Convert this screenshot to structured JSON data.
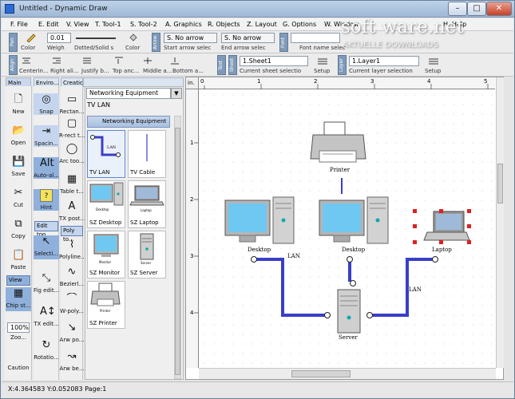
{
  "app": {
    "title": "Untitled - Dynamic Draw",
    "minimize": "–",
    "maximize": "□",
    "close": "✕"
  },
  "menu": {
    "items": [
      "F. File",
      "E. Edit",
      "V. View",
      "T. Tool-1",
      "S. Tool-2",
      "A. Graphics",
      "R. Objects",
      "Z. Layout",
      "G. Options",
      "W. Window",
      "H. Help"
    ]
  },
  "toolbar1": {
    "pen_tab": "Pen",
    "line_width_value": "0.01",
    "color_label": "Color",
    "weight_label": "Weigh",
    "line_style_label": "Dotted/Solid s",
    "color2_label": "Color",
    "arrow_tab": "Arrow",
    "start_arrow_value": "S. No arrow",
    "start_arrow_label": "Start arrow selec",
    "end_arrow_value": "S. No arrow",
    "end_arrow_label": "End arrow selec",
    "font_tab": "Font",
    "font_name_label": "Font name selec"
  },
  "toolbar2": {
    "align_tab": "Align",
    "align_labels": [
      "Centerin...",
      "Right ali...",
      "Justify b...",
      "Top anc...",
      "Middle a...",
      "Bottom a..."
    ],
    "text_tab": "Text",
    "sheet_tab": "Sheet",
    "sheet_value": "1.Sheet1",
    "sheet_label": "Current sheet selectio",
    "setup_label": "Setup",
    "layer_tab": "Layer",
    "layer_value": "1.Layer1",
    "layer_label": "Current layer selection",
    "setup2_label": "Setup"
  },
  "left": {
    "main_head": "Main",
    "main_tools": [
      "New",
      "Open",
      "Save",
      "Cut",
      "Copy",
      "Paste"
    ],
    "view_head": "View",
    "chip_label": "Chip st...",
    "zoom_value": "100%",
    "zoom_label": "Zoo...",
    "caution_label": "Caution",
    "enviro_head": "Enviro...",
    "enviro_tools": [
      "Snap",
      "Spacin...",
      "Auto-al...",
      "Hint"
    ],
    "edit_head": "Edit too...",
    "edit_tools": [
      "Selecti...",
      "Fig edit...",
      "TX edit...",
      "Rotatio..."
    ],
    "creation_head": "Creatio",
    "creation_tools": [
      "Rectan...",
      "R-rect t...",
      "Arc too...",
      "Table t...",
      "TX post...",
      "Polyline..."
    ],
    "poly_head": "Poly to...",
    "poly_tools": [
      "Bezierl...",
      "W-poly...",
      "Arw po...",
      "Arw be..."
    ]
  },
  "library": {
    "selected": "Networking Equipment",
    "title": "TV LAN",
    "header": "Networking Equipment",
    "tiles": [
      "TV LAN",
      "TV Cable",
      "SZ Desktop",
      "SZ Laptop",
      "SZ Monitor",
      "SZ Server",
      "SZ Printer"
    ],
    "mini_labels": {
      "tv_lan": "LAN",
      "desktop": "Desktop",
      "laptop": "Laptop",
      "monitor": "Monitor",
      "server": "Server",
      "printer": "Printer"
    }
  },
  "canvas": {
    "unit": "in.",
    "ruler_top": [
      "0",
      "1",
      "2",
      "3",
      "4",
      "5"
    ],
    "ruler_left": [
      "1",
      "2",
      "3",
      "4"
    ],
    "labels": {
      "printer": "Printer",
      "desktop_left": "Desktop",
      "desktop_mid": "Desktop",
      "laptop": "Laptop",
      "server": "Server",
      "lan_left": "LAN",
      "lan_right": "LAN"
    }
  },
  "status": {
    "text": "X:4.364583 Y:0.052083 Page:1"
  },
  "watermark": {
    "line1": "soft ware.net",
    "line2": "AKTUELLE DOWNLOADS"
  },
  "colors": {
    "accent": "#3a3ec8",
    "selection": "#e02020",
    "panel_head": "#a8c0e2"
  }
}
